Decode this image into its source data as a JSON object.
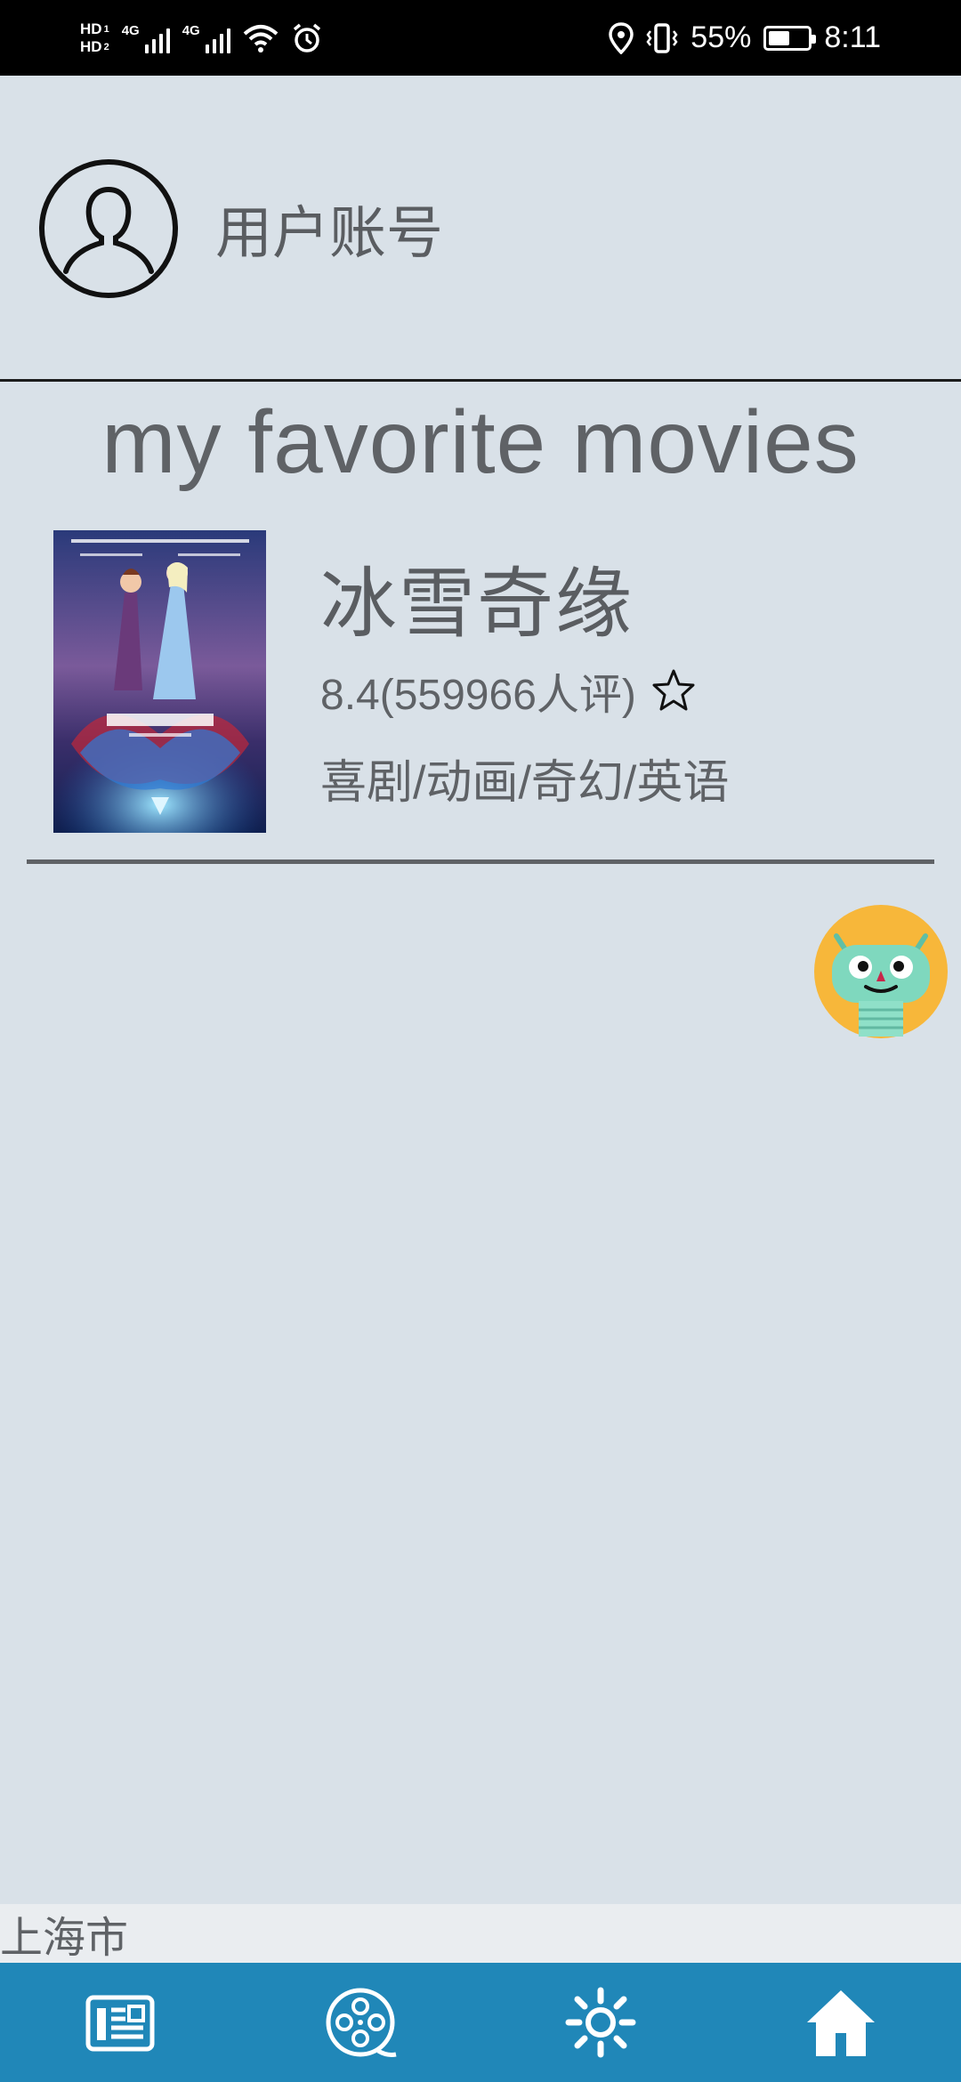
{
  "status_bar": {
    "hd1": "HD",
    "hd1_sub": "1",
    "hd2": "HD",
    "hd2_sub": "2",
    "network1": "4G",
    "network2": "4G",
    "battery_percent": "55%",
    "battery_level": 0.55,
    "time": "8:11",
    "icons": [
      "signal-icon",
      "wifi-icon",
      "alarm-icon",
      "location-icon",
      "vibrate-icon",
      "battery-icon"
    ]
  },
  "header": {
    "avatar_icon": "user-avatar-icon",
    "account_label": "用户账号"
  },
  "section": {
    "title": "my favorite movies"
  },
  "movies": [
    {
      "title": "冰雪奇缘",
      "rating": "8.4(559966人评)",
      "genres": "喜剧/动画/奇幻/英语",
      "poster_icon": "movie-poster",
      "favorite_icon": "star-outline-icon"
    }
  ],
  "floating": {
    "icon": "robot-assistant-icon"
  },
  "location": {
    "city": "上海市"
  },
  "bottom_nav": {
    "items": [
      {
        "icon": "news-icon"
      },
      {
        "icon": "film-reel-icon"
      },
      {
        "icon": "sun-icon"
      },
      {
        "icon": "home-icon"
      }
    ]
  },
  "colors": {
    "background": "#d9e1e8",
    "nav_bar": "#2087b8",
    "text": "#5f6266",
    "robot_face": "#f7b73a",
    "robot_head": "#7fd8be"
  }
}
